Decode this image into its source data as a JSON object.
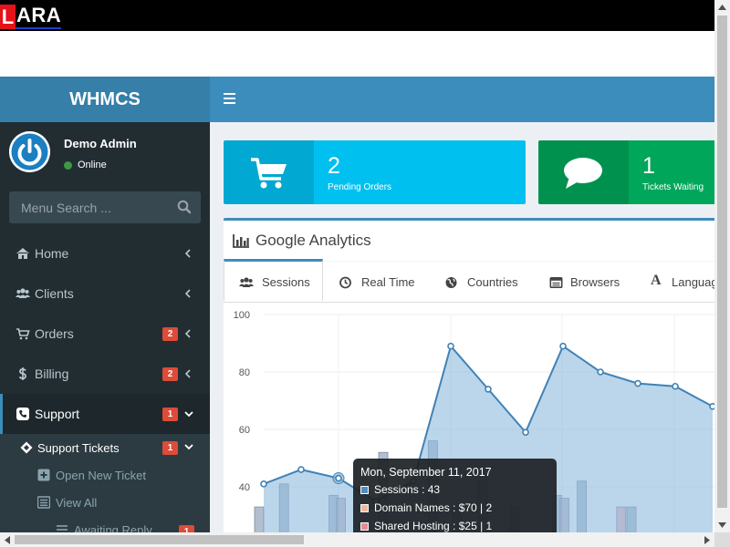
{
  "top_banner": {
    "logo_first": "L",
    "logo_rest": "ARA"
  },
  "brand": "WHMCS",
  "user": {
    "name": "Demo Admin",
    "status": "Online",
    "status_color": "#3c9a42"
  },
  "menu_search": {
    "placeholder": "Menu Search ..."
  },
  "sidebar": {
    "items": [
      {
        "label": "Home",
        "icon": "home-icon"
      },
      {
        "label": "Clients",
        "icon": "users-icon"
      },
      {
        "label": "Orders",
        "icon": "cart-icon",
        "badge": "2"
      },
      {
        "label": "Billing",
        "icon": "dollar-icon",
        "badge": "2"
      },
      {
        "label": "Support",
        "icon": "phone-icon",
        "badge": "1",
        "active": true
      }
    ],
    "submenu": {
      "header": {
        "label": "Support Tickets",
        "badge": "1"
      },
      "items": [
        {
          "label": "Open New Ticket",
          "icon": "plus-square-icon"
        },
        {
          "label": "View All",
          "icon": "list-icon"
        },
        {
          "label": "Awaiting Reply",
          "icon": "list-icon",
          "badge": "1"
        }
      ]
    }
  },
  "info_boxes": [
    {
      "number": "2",
      "label": "Pending Orders",
      "color": "#00c0ef",
      "icon": "shopping-cart-icon"
    },
    {
      "number": "1",
      "label": "Tickets Waiting",
      "color": "#00a65a",
      "icon": "comment-icon"
    }
  ],
  "analytics": {
    "title": "Google Analytics",
    "tabs": [
      "Sessions",
      "Real Time",
      "Countries",
      "Browsers",
      "Languag"
    ]
  },
  "tooltip": {
    "title": "Mon, September 11, 2017",
    "rows": [
      {
        "text": "Sessions : 43",
        "color": "#4f8ec2"
      },
      {
        "text": "Domain Names : $70 | 2",
        "color": "#f0b89a"
      },
      {
        "text": "Shared Hosting : $25 | 1",
        "color": "#e88a95"
      }
    ]
  },
  "colors": {
    "accent": "#3c8dbc",
    "sidebar_bg": "#222d32",
    "badge": "#dd4b39"
  },
  "chart_data": {
    "type": "area",
    "y_ticks": [
      "100",
      "80",
      "60",
      "40"
    ],
    "ylim": [
      30,
      100
    ],
    "series": [
      {
        "values": [
          41,
          46,
          43,
          35,
          42,
          89,
          74,
          59,
          89,
          80,
          76,
          75,
          68
        ]
      }
    ],
    "bars": [
      {
        "values": [
          33,
          41,
          0,
          37,
          0,
          52,
          0,
          56,
          34,
          42,
          0,
          0,
          37,
          42,
          0,
          33
        ]
      },
      {
        "values": [
          0,
          0,
          0,
          36,
          0,
          0,
          0,
          0,
          0,
          0,
          33,
          0,
          36,
          0,
          0,
          0
        ]
      },
      {
        "values": [
          0,
          0,
          0,
          0,
          0,
          0,
          0,
          0,
          0,
          0,
          0,
          0,
          0,
          0,
          33,
          0
        ]
      }
    ]
  }
}
